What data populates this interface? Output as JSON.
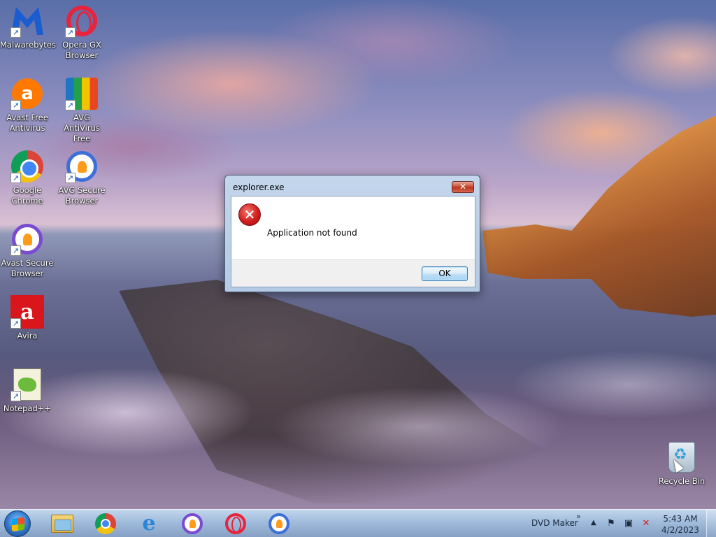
{
  "desktop": {
    "icons": [
      {
        "label": "Malwarebytes",
        "icon": "malwarebytes-icon"
      },
      {
        "label": "Opera GX Browser",
        "icon": "opera-gx-icon"
      },
      {
        "label": "Avast Free Antivirus",
        "icon": "avast-icon"
      },
      {
        "label": "AVG AntiVirus Free",
        "icon": "avg-icon"
      },
      {
        "label": "Google Chrome",
        "icon": "chrome-icon"
      },
      {
        "label": "AVG Secure Browser",
        "icon": "avg-secure-browser-icon"
      },
      {
        "label": "Avast Secure Browser",
        "icon": "avast-secure-browser-icon"
      },
      {
        "label": "Avira",
        "icon": "avira-icon"
      },
      {
        "label": "Notepad++",
        "icon": "notepad-plus-plus-icon"
      },
      {
        "label": "Recycle Bin",
        "icon": "recycle-bin-icon"
      }
    ],
    "shortcut_arrow": "↗"
  },
  "dialog": {
    "title": "explorer.exe",
    "close_glyph": "✕",
    "error_glyph": "✕",
    "message": "Application not found",
    "ok_label": "OK"
  },
  "taskbar": {
    "pinned": [
      {
        "name": "windows-explorer",
        "icon": "folder-icon"
      },
      {
        "name": "google-chrome",
        "icon": "chrome-icon"
      },
      {
        "name": "internet-explorer",
        "icon": "internet-explorer-icon"
      },
      {
        "name": "avast-secure-browser",
        "icon": "avast-secure-browser-icon"
      },
      {
        "name": "opera-gx",
        "icon": "opera-gx-icon"
      },
      {
        "name": "avg-secure-browser",
        "icon": "avg-secure-browser-icon"
      }
    ],
    "ie_glyph": "e",
    "toolbar_label": "DVD Maker",
    "toolbar_chevron": "»",
    "tray_arrow": "▲",
    "tray_icons": [
      {
        "name": "action-center-flag-icon",
        "glyph": "⚑"
      },
      {
        "name": "network-icon",
        "glyph": "▣"
      },
      {
        "name": "volume-muted-icon",
        "glyph": "✕"
      }
    ],
    "clock_time": "5:43 AM",
    "clock_date": "4/2/2023"
  },
  "colors": {
    "dialog_frame": "#b5cae4",
    "error_red": "#d21d1d",
    "ok_button_border": "#3c7fb1"
  }
}
